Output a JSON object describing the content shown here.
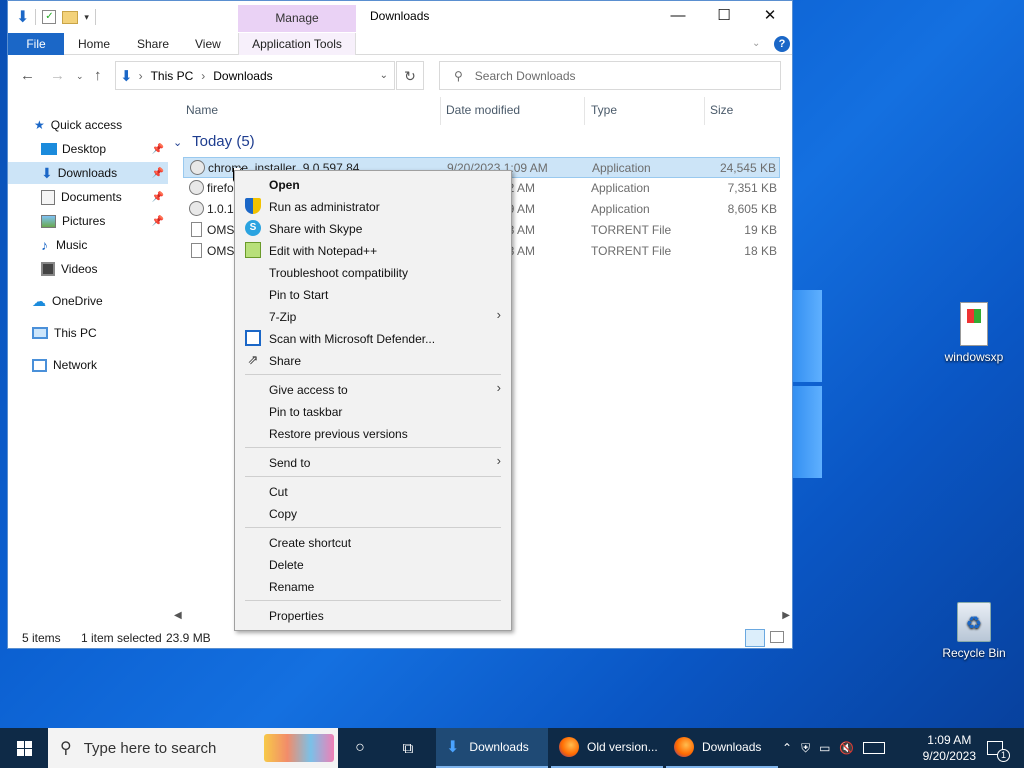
{
  "window": {
    "title": "Downloads",
    "manage_tab": "Manage",
    "ribbon_tabs": [
      "File",
      "Home",
      "Share",
      "View",
      "Application Tools"
    ],
    "controls": {
      "minimize": "—",
      "maximize": "☐",
      "close": "✕"
    }
  },
  "address": {
    "crumbs": [
      "This PC",
      "Downloads"
    ],
    "separator": "›"
  },
  "search": {
    "placeholder": "Search Downloads"
  },
  "sidebar": {
    "items": [
      {
        "label": "Quick access",
        "icon": "star-icon"
      },
      {
        "label": "Desktop",
        "icon": "desktop-icon"
      },
      {
        "label": "Downloads",
        "icon": "download-arrow-icon"
      },
      {
        "label": "Documents",
        "icon": "documents-icon"
      },
      {
        "label": "Pictures",
        "icon": "pictures-icon"
      },
      {
        "label": "Music",
        "icon": "music-icon"
      },
      {
        "label": "Videos",
        "icon": "videos-icon"
      },
      {
        "label": "OneDrive",
        "icon": "cloud-icon"
      },
      {
        "label": "This PC",
        "icon": "computer-icon"
      },
      {
        "label": "Network",
        "icon": "network-icon"
      }
    ]
  },
  "columns": {
    "name": "Name",
    "date": "Date modified",
    "type": "Type",
    "size": "Size"
  },
  "group": {
    "label": "Today (5)"
  },
  "files": [
    {
      "name": "chrome_installer_9.0.597.84",
      "date": "9/20/2023 1:09 AM",
      "type": "Application",
      "size": "24,545 KB"
    },
    {
      "name": "firefo",
      "date": "02 AM",
      "type": "Application",
      "size": "7,351 KB"
    },
    {
      "name": "1.0.15",
      "date": "59 AM",
      "type": "Application",
      "size": "8,605 KB"
    },
    {
      "name": "OMSI",
      "date": "23 AM",
      "type": "TORRENT File",
      "size": "19 KB"
    },
    {
      "name": "OMSI",
      "date": "23 AM",
      "type": "TORRENT File",
      "size": "18 KB"
    }
  ],
  "status": {
    "count": "5 items",
    "selected": "1 item selected",
    "size": "23.9 MB"
  },
  "context_menu": {
    "items": [
      {
        "label": "Open",
        "bold": true
      },
      {
        "label": "Run as administrator",
        "icon": "shield-icon"
      },
      {
        "label": "Share with Skype",
        "icon": "skype-icon"
      },
      {
        "label": "Edit with Notepad++",
        "icon": "notepadpp-icon"
      },
      {
        "label": "Troubleshoot compatibility"
      },
      {
        "label": "Pin to Start"
      },
      {
        "label": "7-Zip",
        "submenu": true
      },
      {
        "label": "Scan with Microsoft Defender...",
        "icon": "defender-icon"
      },
      {
        "label": "Share",
        "icon": "share-icon"
      },
      {
        "label": "Give access to",
        "submenu": true
      },
      {
        "label": "Pin to taskbar"
      },
      {
        "label": "Restore previous versions"
      },
      {
        "label": "Send to",
        "submenu": true
      },
      {
        "label": "Cut"
      },
      {
        "label": "Copy"
      },
      {
        "label": "Create shortcut"
      },
      {
        "label": "Delete"
      },
      {
        "label": "Rename"
      },
      {
        "label": "Properties"
      }
    ]
  },
  "desktop": {
    "icons": [
      {
        "label": "windowsxp"
      },
      {
        "label": "Recycle Bin"
      }
    ]
  },
  "taskbar": {
    "search_placeholder": "Type here to search",
    "tasks": [
      {
        "label": "Downloads",
        "icon": "folder-download-icon",
        "active": true
      },
      {
        "label": "Old version...",
        "icon": "firefox-icon"
      },
      {
        "label": "Downloads",
        "icon": "firefox-icon"
      }
    ],
    "time": "1:09 AM",
    "date": "9/20/2023",
    "notification_count": "1"
  },
  "colors": {
    "accent": "#1b67c7",
    "selection": "#cce4f7",
    "taskbar": "#0e2a47"
  }
}
